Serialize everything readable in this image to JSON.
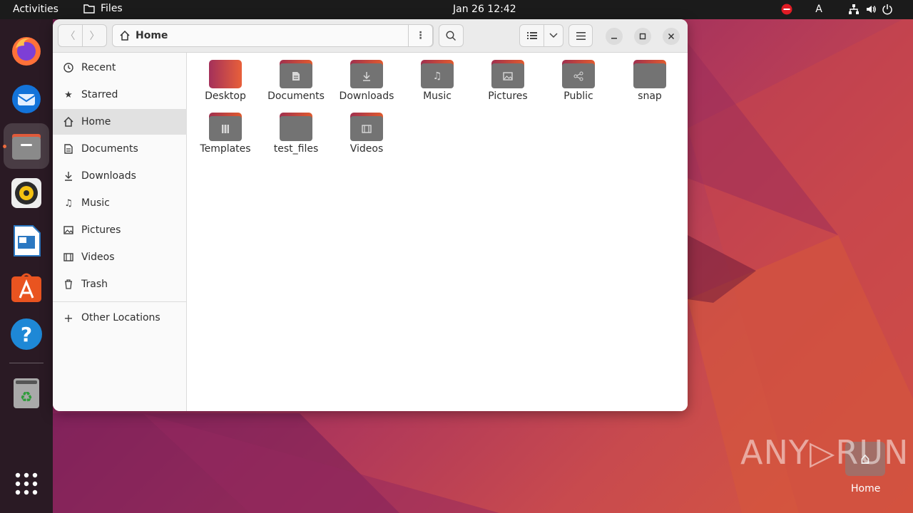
{
  "topbar": {
    "activities": "Activities",
    "app_name": "Files",
    "clock": "Jan 26  12:42",
    "input_indicator": "A"
  },
  "dock": {
    "items": [
      {
        "name": "firefox",
        "icon": "firefox-icon"
      },
      {
        "name": "thunderbird",
        "icon": "thunderbird-icon"
      },
      {
        "name": "files",
        "icon": "files-icon",
        "active": true
      },
      {
        "name": "rhythmbox",
        "icon": "rhythmbox-icon"
      },
      {
        "name": "libreoffice-writer",
        "icon": "writer-icon"
      },
      {
        "name": "app-center",
        "icon": "app-center-icon"
      },
      {
        "name": "help",
        "icon": "help-icon"
      },
      {
        "name": "trash",
        "icon": "trash-icon"
      },
      {
        "name": "show-apps",
        "icon": "grid-icon"
      }
    ]
  },
  "window": {
    "path": "Home"
  },
  "sidebar": {
    "items": [
      {
        "label": "Recent",
        "icon": "clock-icon"
      },
      {
        "label": "Starred",
        "icon": "star-icon"
      },
      {
        "label": "Home",
        "icon": "home-icon",
        "selected": true
      },
      {
        "label": "Documents",
        "icon": "document-icon"
      },
      {
        "label": "Downloads",
        "icon": "download-icon"
      },
      {
        "label": "Music",
        "icon": "music-icon"
      },
      {
        "label": "Pictures",
        "icon": "picture-icon"
      },
      {
        "label": "Videos",
        "icon": "video-icon"
      },
      {
        "label": "Trash",
        "icon": "trash-icon"
      }
    ],
    "other_locations": "Other Locations"
  },
  "folders": [
    {
      "label": "Desktop",
      "icon": "desktop-folder-icon"
    },
    {
      "label": "Documents",
      "icon": "documents-folder-icon"
    },
    {
      "label": "Downloads",
      "icon": "downloads-folder-icon"
    },
    {
      "label": "Music",
      "icon": "music-folder-icon"
    },
    {
      "label": "Pictures",
      "icon": "pictures-folder-icon"
    },
    {
      "label": "Public",
      "icon": "public-folder-icon"
    },
    {
      "label": "snap",
      "icon": "folder-icon"
    },
    {
      "label": "Templates",
      "icon": "templates-folder-icon"
    },
    {
      "label": "test_files",
      "icon": "folder-icon"
    },
    {
      "label": "Videos",
      "icon": "videos-folder-icon"
    }
  ],
  "desktop": {
    "home_label": "Home",
    "watermark": "ANY▷RUN"
  }
}
